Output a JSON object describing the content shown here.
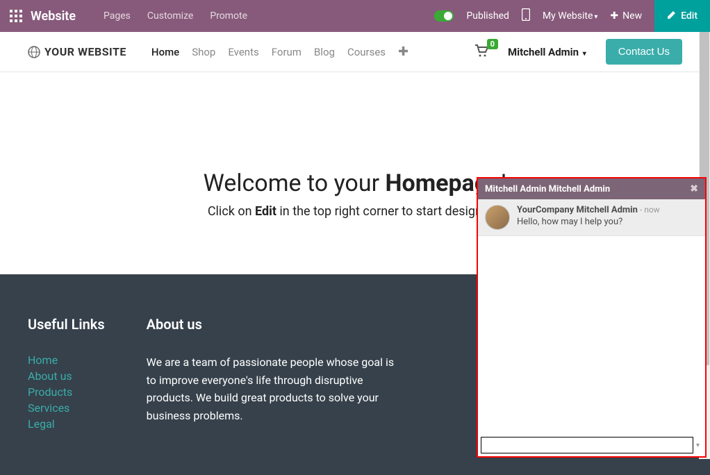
{
  "topbar": {
    "app_name": "Website",
    "menu": [
      "Pages",
      "Customize",
      "Promote"
    ],
    "published_label": "Published",
    "my_website_label": "My Website",
    "new_label": "New",
    "edit_label": "Edit"
  },
  "navbar": {
    "logo_text": "YOUR WEBSITE",
    "links": [
      "Home",
      "Shop",
      "Events",
      "Forum",
      "Blog",
      "Courses"
    ],
    "cart_count": "0",
    "user_name": "Mitchell Admin",
    "contact_label": "Contact Us"
  },
  "hero": {
    "title_prefix": "Welcome to your ",
    "title_bold": "Homepage",
    "title_suffix": "!",
    "sub_prefix": "Click on ",
    "sub_bold": "Edit",
    "sub_suffix": " in the top right corner to start designing."
  },
  "footer": {
    "links_heading": "Useful Links",
    "links": [
      "Home",
      "About us",
      "Products",
      "Services",
      "Legal"
    ],
    "about_heading": "About us",
    "about_text": "We are a team of passionate people whose goal is to improve everyone's life through disruptive products. We build great products to solve your business problems."
  },
  "chat": {
    "header": "Mitchell Admin Mitchell Admin",
    "from": "YourCompany Mitchell Admin",
    "time_sep": " - ",
    "time": "now",
    "message": "Hello, how may I help you?",
    "input_value": ""
  }
}
